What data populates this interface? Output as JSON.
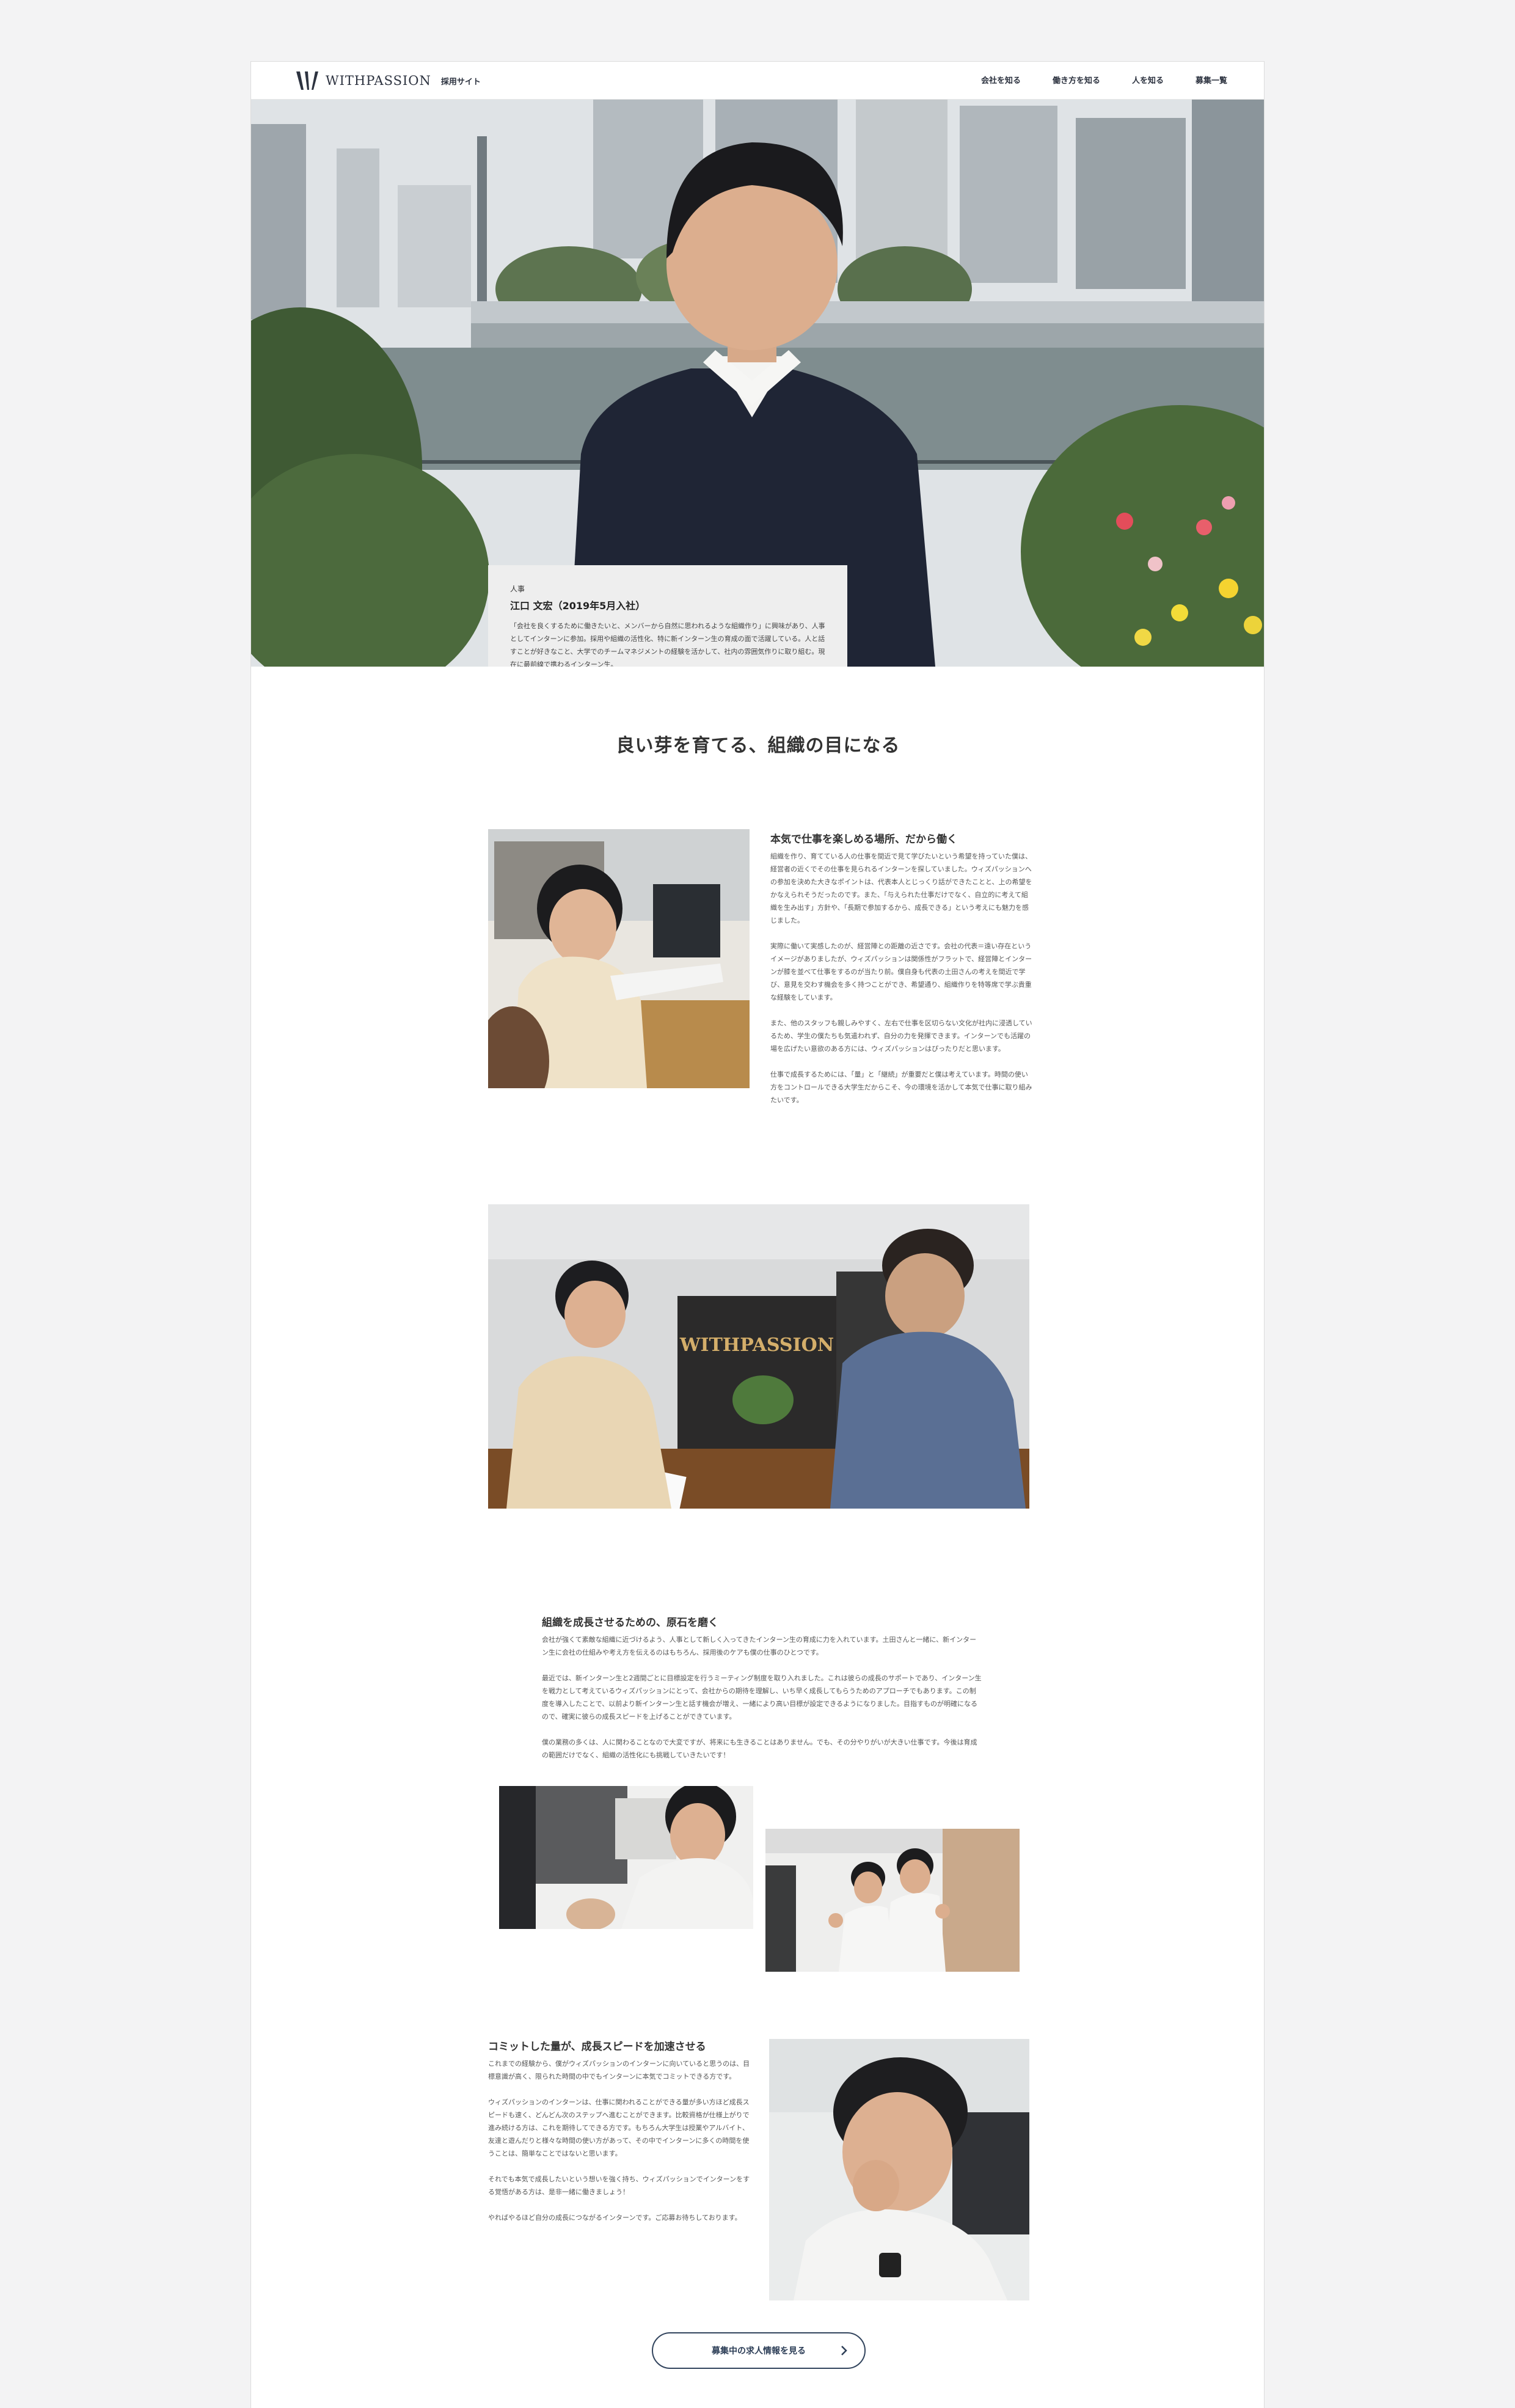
{
  "header": {
    "logo_text": "WITHPASSION",
    "site_label": "採用サイト",
    "nav": [
      {
        "label": "会社を知る"
      },
      {
        "label": "働き方を知る"
      },
      {
        "label": "人を知る"
      },
      {
        "label": "募集一覧"
      }
    ]
  },
  "hero": {
    "profile": {
      "department": "人事",
      "name": "江口 文宏（2019年5月入社）",
      "description": "「会社を良くするために働きたいと、メンバーから自然に思われるような組織作り」に興味があり、人事としてインターンに参加。採用や組織の活性化、特に新インターン生の育成の面で活躍している。人と話すことが好きなこと、大学でのチームマネジメントの経験を活かして、社内の雰囲気作りに取り組む。現在に最前線で携わるインターン生。"
    }
  },
  "lead": "良い芽を育てる、組織の目になる",
  "sections": [
    {
      "title": "本気で仕事を楽しめる場所、だから働く",
      "paragraphs": [
        "組織を作り、育てている人の仕事を間近で見て学びたいという希望を持っていた僕は、経営者の近くでその仕事を見られるインターンを探していました。ウィズパッションへの参加を決めた大きなポイントは、代表本人とじっくり話ができたことと、上の希望をかなえられそうだったのです。また、「与えられた仕事だけでなく、自立的に考えて組織を生み出す」方針や、「長期で参加するから、成長できる」という考えにも魅力を感じました。",
        "実際に働いて実感したのが、経営陣との距離の近さです。会社の代表＝遠い存在というイメージがありましたが、ウィズパッションは関係性がフラットで、経営陣とインターンが膝を並べて仕事をするのが当たり前。僕自身も代表の土田さんの考えを間近で学び、意見を交わす機会を多く持つことができ、希望通り、組織作りを特等席で学ぶ貴重な経験をしています。",
        "また、他のスタッフも親しみやすく、左右で仕事を区切らない文化が社内に浸透しているため、学生の僕たちも気遣われず、自分の力を発揮できます。インターンでも活躍の場を広げたい意欲のある方には、ウィズパッションはぴったりだと思います。",
        "仕事で成長するためには、「量」と「継続」が重要だと僕は考えています。時間の使い方をコントロールできる大学生だからこそ、今の環境を活かして本気で仕事に取り組みたいです。"
      ]
    },
    {
      "title": "組織を成長させるための、原石を磨く",
      "paragraphs": [
        "会社が強くて素敵な組織に近づけるよう、人事として新しく入ってきたインターン生の育成に力を入れています。土田さんと一緒に、新インターン生に会社の仕組みや考え方を伝えるのはもちろん、採用後のケアも僕の仕事のひとつです。",
        "最近では、新インターン生と2週間ごとに目標設定を行うミーティング制度を取り入れました。これは彼らの成長のサポートであり、インターン生を戦力として考えているウィズパッションにとって、会社からの期待を理解し、いち早く成長してもらうためのアプローチでもあります。この制度を導入したことで、以前より新インターン生と話す機会が増え、一緒により高い目標が設定できるようになりました。目指すものが明確になるので、確実に彼らの成長スピードを上げることができています。",
        "僕の業務の多くは、人に関わることなので大変ですが、将来にも生きることはありません。でも、その分やりがいが大きい仕事です。今後は育成の範囲だけでなく、組織の活性化にも挑戦していきたいです！"
      ]
    },
    {
      "title": "コミットした量が、成長スピードを加速させる",
      "paragraphs": [
        "これまでの経験から、僕がウィズパッションのインターンに向いていると思うのは、目標意識が高く、限られた時間の中でもインターンに本気でコミットできる方です。",
        "ウィズパッションのインターンは、仕事に関われることができる量が多い方ほど成長スピードも速く、どんどん次のステップへ進むことができます。比較資格が仕様上がりで進み続ける方は、これを期待してできる方です。もちろん大学生は授業やアルバイト、友達と遊んだりと様々な時間の使い方があって、その中でインターンに多くの時間を使うことは、簡単なことではないと思います。",
        "それでも本気で成長したいという想いを強く持ち、ウィズパッションでインターンをする覚悟がある方は、是非一緒に働きましょう！",
        "やればやるほど自分の成長につながるインターンです。ご応募お待ちしております。"
      ]
    }
  ],
  "cta": {
    "label": "募集中の求人情報を見る"
  },
  "colors": {
    "accent": "#2d3e57",
    "page_bg": "#f3f3f4",
    "card_bg": "#eeeeee"
  }
}
